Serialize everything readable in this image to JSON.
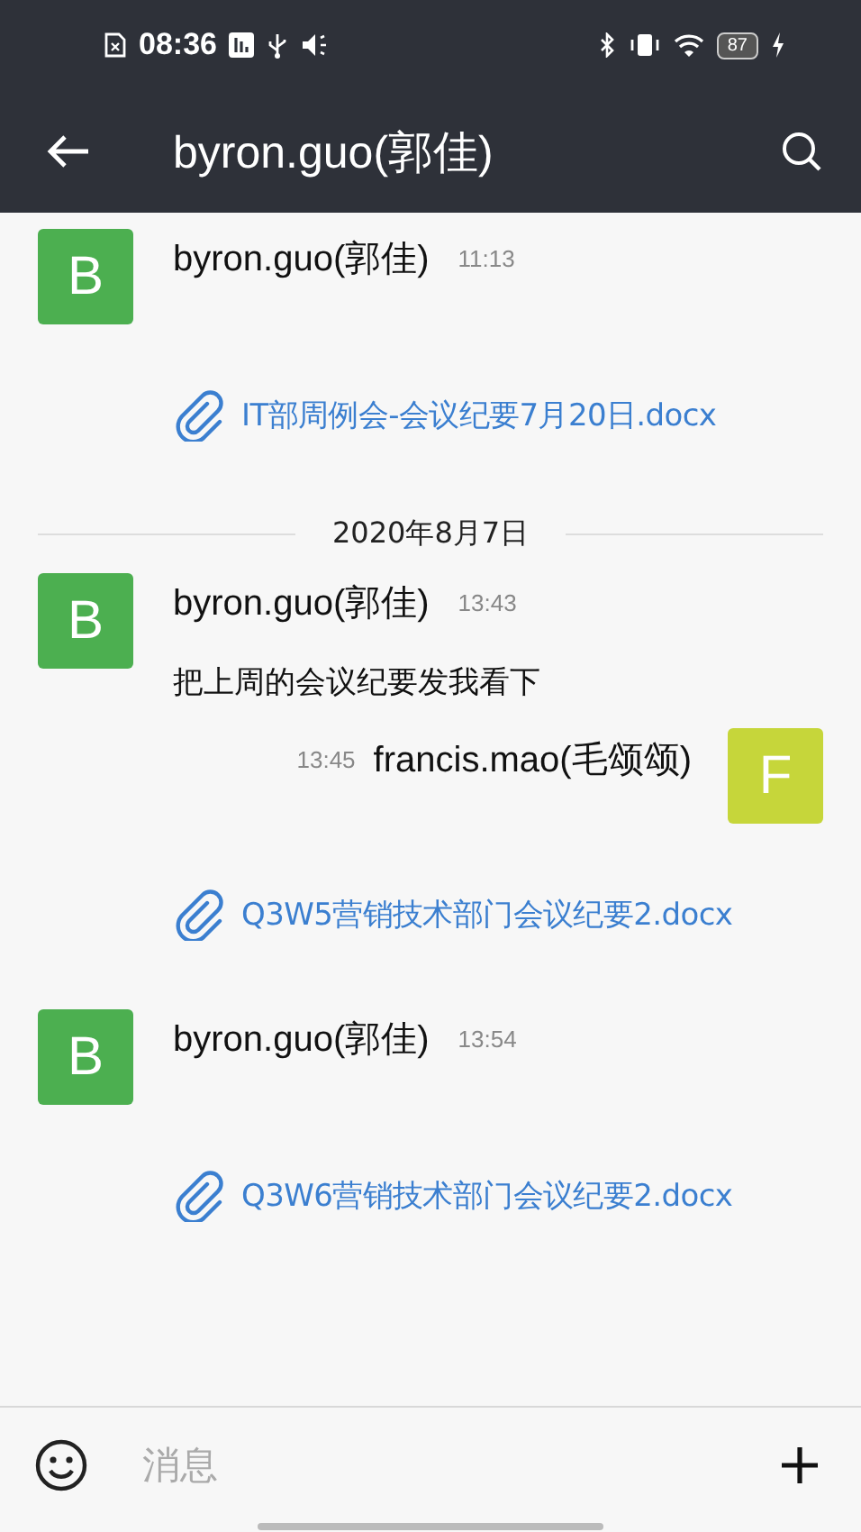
{
  "status_bar": {
    "time": "08:36",
    "battery": "87"
  },
  "header": {
    "title": "byron.guo(郭佳)"
  },
  "items": [
    {
      "kind": "incoming",
      "avatar": "B",
      "color": "#4caf50",
      "sender": "byron.guo(郭佳)",
      "time": "11:13"
    },
    {
      "kind": "file",
      "name": "IT部周例会-会议纪要7月20日.docx"
    },
    {
      "kind": "date",
      "label": "2020年8月7日"
    },
    {
      "kind": "incoming",
      "avatar": "B",
      "color": "#4caf50",
      "sender": "byron.guo(郭佳)",
      "time": "13:43",
      "text": "把上周的会议纪要发我看下"
    },
    {
      "kind": "outgoing",
      "avatar": "F",
      "color": "#c6d63a",
      "sender": "francis.mao(毛颂颂)",
      "time": "13:45"
    },
    {
      "kind": "file",
      "name": "Q3W5营销技术部门会议纪要2.docx"
    },
    {
      "kind": "incoming",
      "avatar": "B",
      "color": "#4caf50",
      "sender": "byron.guo(郭佳)",
      "time": "13:54"
    },
    {
      "kind": "file",
      "name": "Q3W6营销技术部门会议纪要2.docx"
    }
  ],
  "composer": {
    "placeholder": "消息"
  }
}
